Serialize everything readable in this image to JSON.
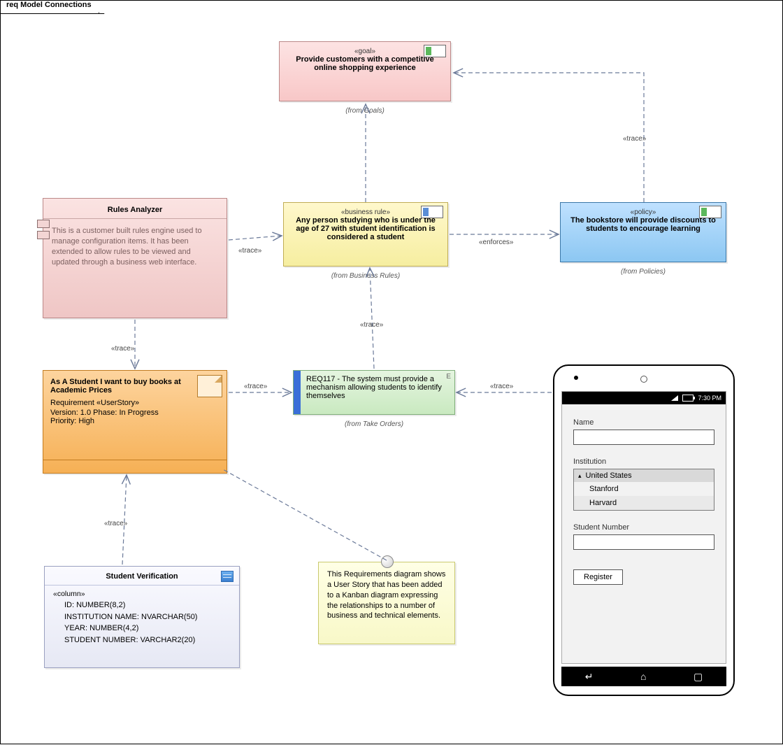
{
  "frame": {
    "title": "req Model Connections"
  },
  "goal": {
    "stereo": "«goal»",
    "text": "Provide customers with a competitive online shopping experience",
    "from": "(from Goals)"
  },
  "policy": {
    "stereo": "«policy»",
    "text": "The bookstore will provide discounts to students to encourage learning",
    "from": "(from Policies)"
  },
  "rule": {
    "stereo": "«business rule»",
    "text": "Any person studying who is under the age of 27 with student identification is considered a student",
    "from": "(from Business Rules)"
  },
  "req": {
    "title": "REQ117 - The system must provide a mechanism allowing students to identify themselves",
    "from": "(from Take Orders)"
  },
  "userstory": {
    "title": "As A Student I want to buy books at Academic Prices",
    "type": "Requirement «UserStory»",
    "meta": "Version: 1.0 Phase: In Progress",
    "priority": "Priority: High"
  },
  "component": {
    "title": "Rules Analyzer",
    "desc": "This is a customer built rules engine used to manage configuration items. It has been extended to allow rules to be viewed and updated through a business web interface."
  },
  "table": {
    "title": "Student Verification",
    "section": "«column»",
    "cols": [
      "ID: NUMBER(8,2)",
      "INSTITUTION NAME: NVARCHAR(50)",
      "YEAR: NUMBER(4,2)",
      "STUDENT NUMBER: VARCHAR2(20)"
    ]
  },
  "note": {
    "text": "This Requirements diagram shows a User Story that has been added to a Kanban diagram expressing the relationships to a number of business and technical elements."
  },
  "phone": {
    "time": "7:30 PM",
    "labels": {
      "name": "Name",
      "institution": "Institution",
      "sn": "Student Number"
    },
    "list": {
      "header": "United States",
      "items": [
        "Stanford",
        "Harvard"
      ]
    },
    "button": "Register"
  },
  "edges": {
    "trace": "«trace»",
    "enforces": "«enforces»"
  }
}
